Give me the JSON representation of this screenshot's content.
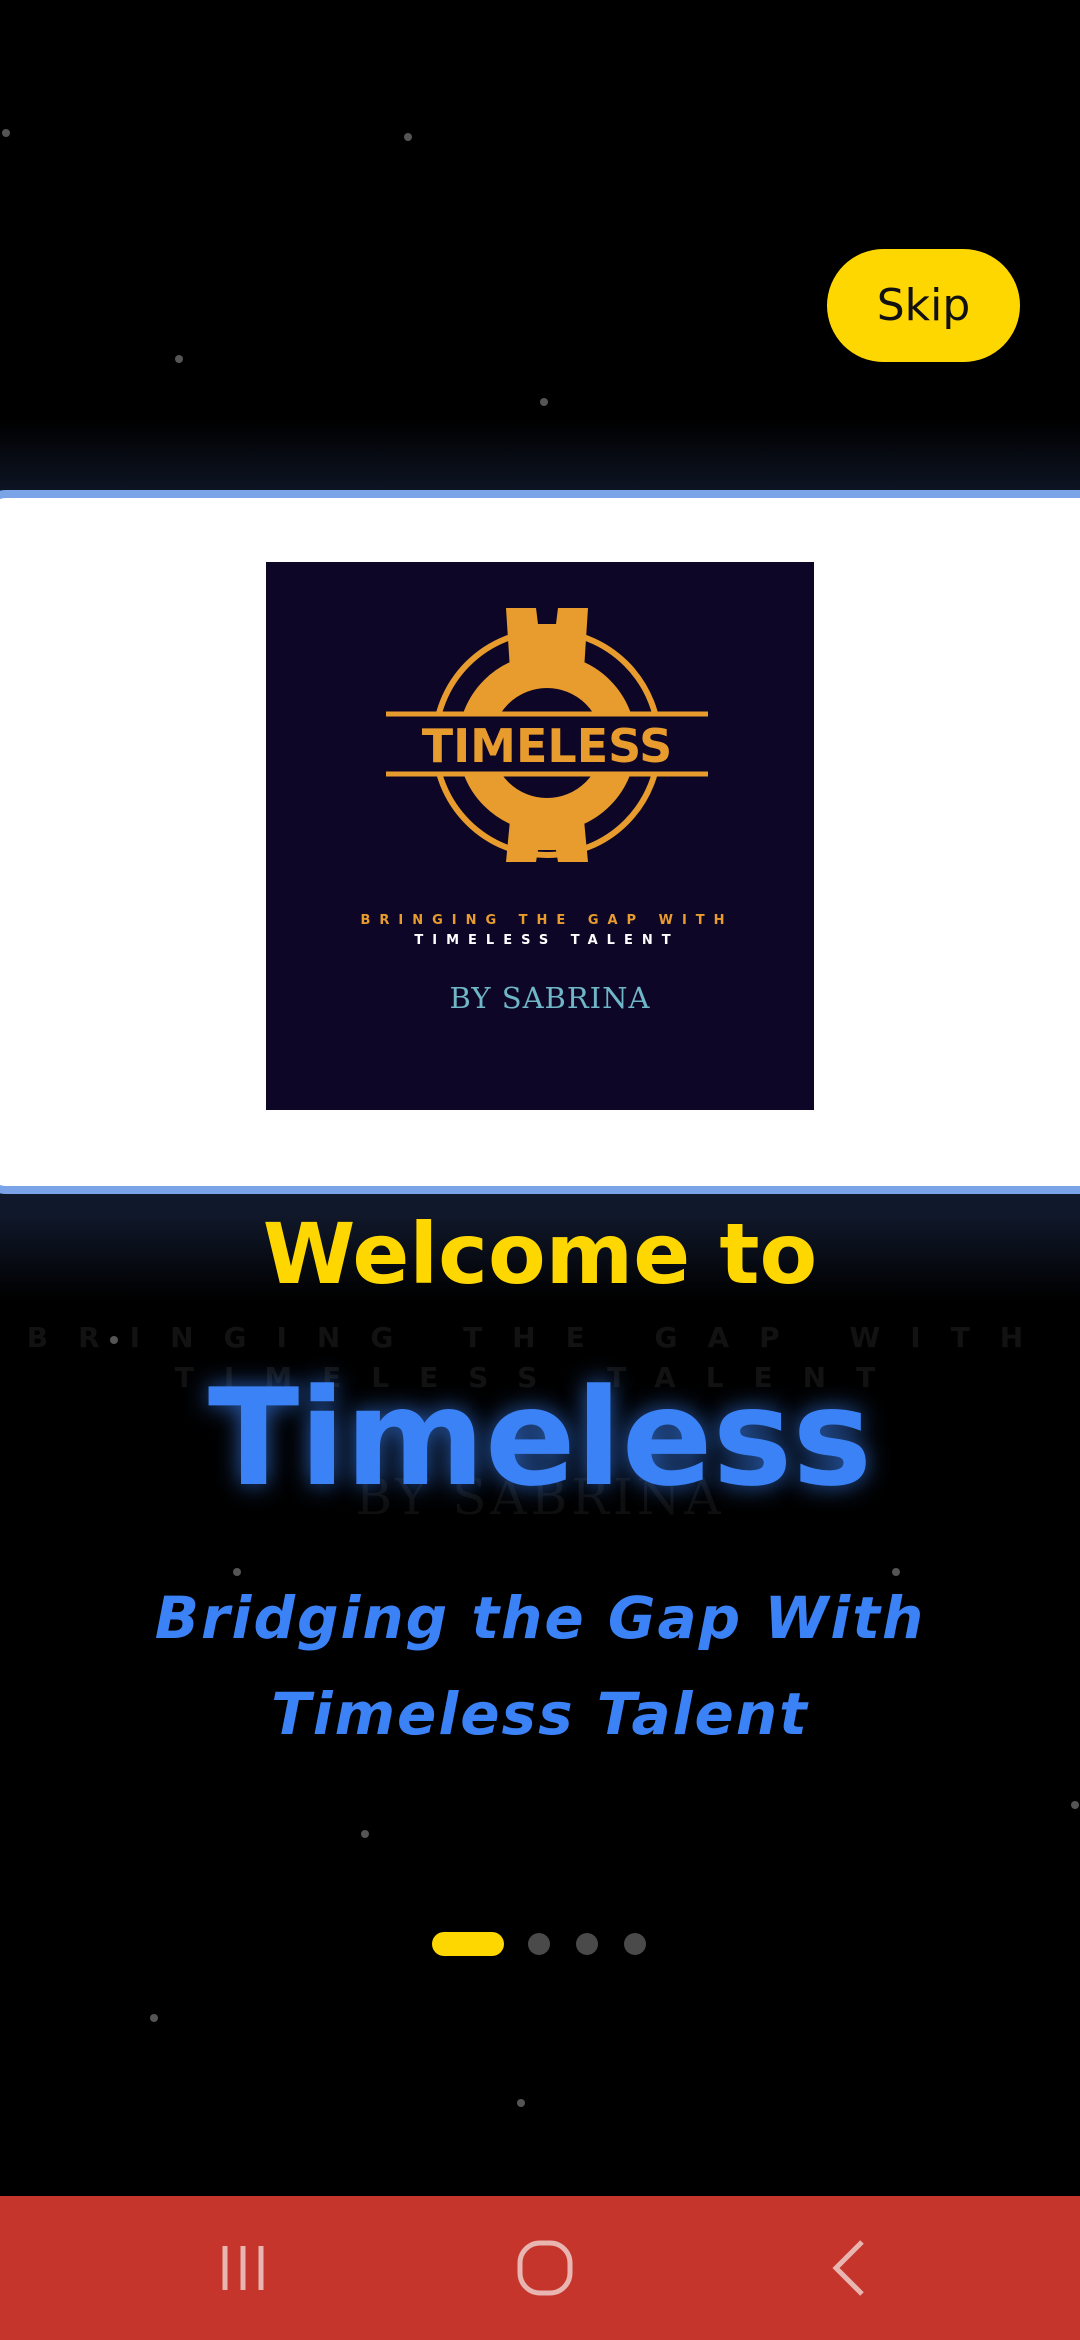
{
  "header": {
    "skip_label": "Skip"
  },
  "logo": {
    "brand_text": "TIMELESS",
    "tagline_line1": "BRINGING THE GAP WITH",
    "tagline_line2": "TIMELESS TALENT",
    "byline": "BY SABRINA",
    "colors": {
      "background": "#0E0626",
      "emblem": "#E89C2E",
      "byline": "#6FB6C6",
      "tagline_white": "#FFFFFF"
    }
  },
  "onboarding": {
    "welcome": "Welcome to",
    "title": "Timeless",
    "subtitle_line1": "Bridging the Gap With",
    "subtitle_line2": "Timeless Talent",
    "ghost_tagline_line1": "BRINGING THE GAP WITH",
    "ghost_tagline_line2": "TIMELESS TALENT",
    "ghost_byline": "BY SABRINA",
    "page_count": 4,
    "current_page": 1
  },
  "nav_bar": {
    "recents_icon": "recents-icon",
    "home_icon": "home-icon",
    "back_icon": "back-icon"
  },
  "colors": {
    "background": "#000000",
    "accent_yellow": "#FFD700",
    "accent_blue": "#3B82F6",
    "card_border": "#7AA3E8",
    "nav_bar": "#C5352C"
  }
}
